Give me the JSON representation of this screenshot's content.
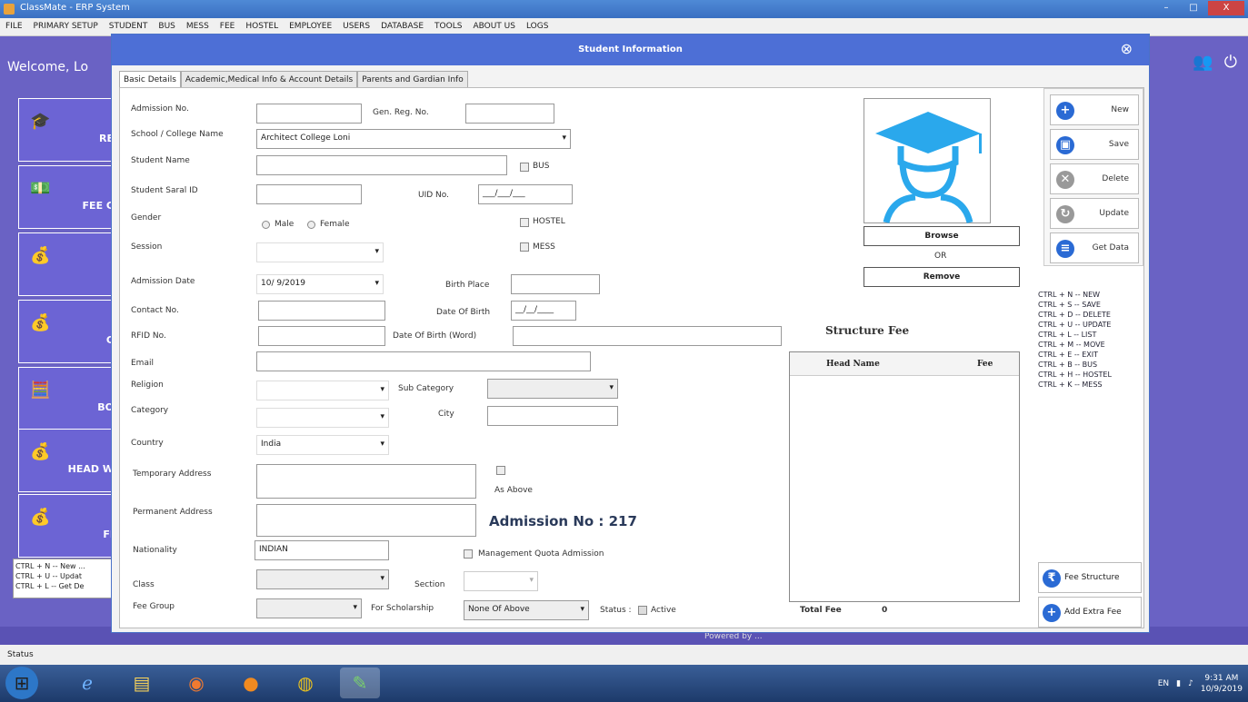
{
  "window": {
    "title": "ClassMate - ERP System",
    "min": "–",
    "max": "□",
    "close": "X"
  },
  "menu": [
    "FILE",
    "PRIMARY SETUP",
    "STUDENT",
    "BUS",
    "MESS",
    "FEE",
    "HOSTEL",
    "EMPLOYEE",
    "USERS",
    "DATABASE",
    "TOOLS",
    "ABOUT US",
    "LOGS"
  ],
  "welcome": "Welcome, Lo",
  "tiles": [
    {
      "label": "RE",
      "icon": "graduate-icon"
    },
    {
      "label": "FEE C",
      "icon": "money-icon"
    },
    {
      "label": "",
      "icon": "money-bag-icon"
    },
    {
      "label": "C",
      "icon": "money-bag-icon"
    },
    {
      "label": "BO",
      "icon": "calculator-icon"
    },
    {
      "label": "HEAD W",
      "icon": "money-bag-icon"
    },
    {
      "label": "FI",
      "icon": "money-bag-icon"
    }
  ],
  "left_shortcuts": [
    "CTRL + N -- New ...",
    "CTRL + U -- Updat",
    "CTRL + L -- Get De"
  ],
  "powered_by": "Powered by ...",
  "status": "Status",
  "dialog": {
    "title": "Student Information",
    "tabs": [
      "Basic Details",
      "Academic,Medical Info & Account Details",
      "Parents and Gardian Info"
    ]
  },
  "form": {
    "admission_no_label": "Admission No.",
    "gen_reg_label": "Gen. Reg. No.",
    "school_label": "School / College Name",
    "school_value": "Architect College Loni",
    "student_name_label": "Student Name",
    "bus_label": "BUS",
    "saral_label": "Student Saral ID",
    "uid_label": "UID No.",
    "uid_value": "___/___/___",
    "gender_label": "Gender",
    "male": "Male",
    "female": "Female",
    "hostel_label": "HOSTEL",
    "session_label": "Session",
    "mess_label": "MESS",
    "admission_date_label": "Admission Date",
    "admission_date_value": "10/ 9/2019",
    "birth_place_label": "Birth Place",
    "contact_label": "Contact No.",
    "dob_label": "Date Of Birth",
    "dob_value": "__/__/____",
    "rfid_label": "RFID No.",
    "dob_word_label": "Date Of Birth (Word)",
    "email_label": "Email",
    "religion_label": "Religion",
    "sub_category_label": "Sub Category",
    "category_label": "Category",
    "city_label": "City",
    "country_label": "Country",
    "country_value": "India",
    "temp_addr_label": "Temporary Address",
    "as_above_label": "As Above",
    "perm_addr_label": "Permanent Address",
    "admission_no_big": "Admission No : 217",
    "nationality_label": "Nationality",
    "nationality_value": "INDIAN",
    "mgmt_quota_label": "Management Quota Admission",
    "class_label": "Class",
    "section_label": "Section",
    "fee_group_label": "Fee Group",
    "scholarship_label": "For Scholarship",
    "scholarship_value": "None Of Above",
    "status_label": "Status :",
    "active_label": "Active"
  },
  "photo": {
    "browse": "Browse",
    "or": "OR",
    "remove": "Remove"
  },
  "structure": {
    "title": "Structure Fee",
    "col_head": "Head Name",
    "col_fee": "Fee",
    "total_label": "Total Fee",
    "total_value": "0"
  },
  "actions": {
    "new": "New",
    "save": "Save",
    "delete": "Delete",
    "update": "Update",
    "get_data": "Get Data",
    "fee_structure": "Fee Structure",
    "add_extra_fee": "Add Extra Fee"
  },
  "shortcuts": [
    "CTRL + N -- NEW",
    "CTRL + S -- SAVE",
    "CTRL + D -- DELETE",
    "CTRL + U -- UPDATE",
    "CTRL + L -- LIST",
    "CTRL + M -- MOVE",
    "CTRL + E -- EXIT",
    "CTRL + B -- BUS",
    "CTRL + H -- HOSTEL",
    "CTRL + K -- MESS"
  ],
  "clock": {
    "time": "9:31 AM",
    "date": "10/9/2019"
  },
  "tray": {
    "lang": "EN"
  }
}
